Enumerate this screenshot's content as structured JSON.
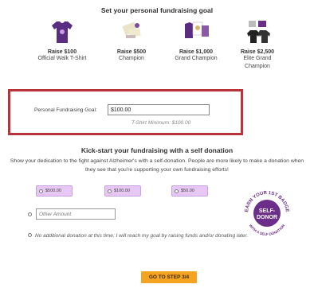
{
  "header": {
    "title": "Set your personal fundraising goal"
  },
  "tiers": [
    {
      "amount": "Raise $100",
      "reward": "Official Walk T-Shirt",
      "icon": "tshirt-icon"
    },
    {
      "amount": "Raise $500",
      "reward": "Champion",
      "icon": "champion-items-icon"
    },
    {
      "amount": "Raise $1,000",
      "reward": "Grand Champion",
      "icon": "grand-champion-items-icon"
    },
    {
      "amount": "Raise $2,500",
      "reward_line1": "Elite Grand",
      "reward_line2": "Champion",
      "icon": "elite-items-icon"
    }
  ],
  "goal": {
    "label": "Personal Fundraising Goal:",
    "value": "$100.00",
    "minimum_note": "T-Shirt Minimum:  $100.00"
  },
  "self_donation": {
    "title": "Kick-start your fundraising with a self donation",
    "description": "Show your dedication to the fight against Alzheimer's with a self-donation. People are more likely to make a donation when they see that you're supporting your own fundraising efforts!",
    "amounts": [
      "$500.00",
      "$100.00",
      "$50.00"
    ],
    "other_placeholder": "Other Amount",
    "no_donation_text": "No additional donation at this time; I will reach my goal by raising funds and/or donating later."
  },
  "badge": {
    "top_text": "EARN YOUR 1ST BADGE",
    "line1": "SELF-",
    "line2": "DONOR",
    "bottom_text": "WITH A SELF DONATION"
  },
  "cta": {
    "label": "GO TO STEP 3/4"
  },
  "colors": {
    "highlight_border": "#b8343a",
    "amount_button_bg": "#e7c8f4",
    "badge_purple": "#6b2f8a",
    "cta_orange": "#f5a323"
  }
}
